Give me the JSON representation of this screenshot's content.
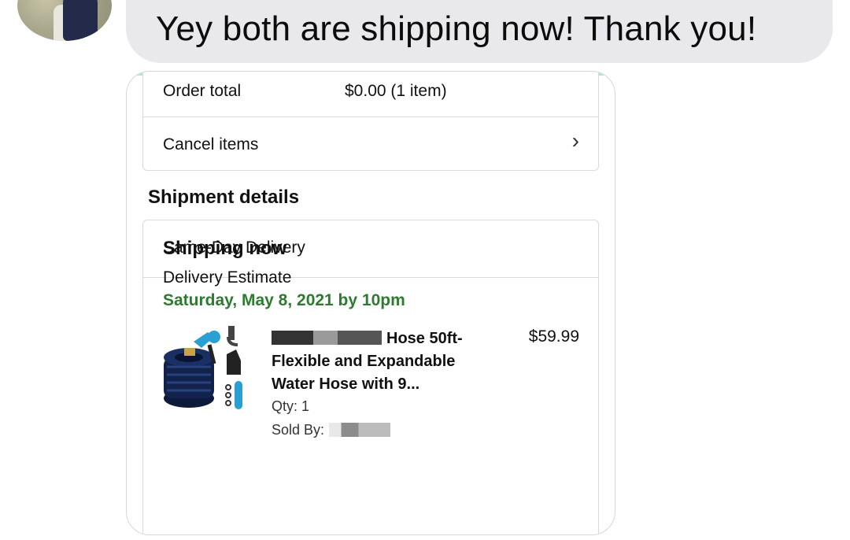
{
  "message": {
    "text": "Yey both are shipping now! Thank you!"
  },
  "order": {
    "total_label": "Order total",
    "total_value": "$0.00 (1 item)",
    "cancel_label": "Cancel items"
  },
  "shipment": {
    "section_title": "Shipment details",
    "delivery_type": "Same-Day Delivery",
    "status": "Shipping now",
    "estimate_label": "Delivery Estimate",
    "estimate_date": "Saturday, May 8, 2021 by 10pm",
    "accent_color": "#2f7a31"
  },
  "product": {
    "title_visible": "Hose 50ft- Flexible and Expandable Water Hose with 9...",
    "price": "$59.99",
    "qty": "Qty: 1",
    "sold_by_label": "Sold By:"
  },
  "icons": {
    "chevron": "chevron-right-icon"
  }
}
